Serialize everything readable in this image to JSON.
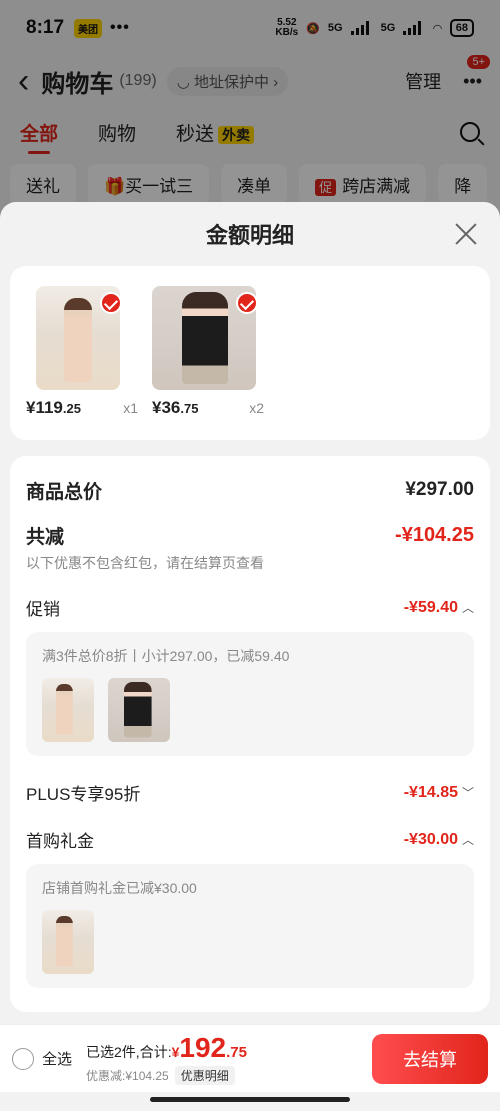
{
  "status_bar": {
    "time": "8:17",
    "badge": "美团",
    "dots": "•••",
    "speed_top": "5.52",
    "speed_bottom": "KB/s",
    "network1": "5G",
    "network2": "5G",
    "battery": "68"
  },
  "nav": {
    "title": "购物车",
    "count": "(199)",
    "address": "◡ 地址保护中 ›",
    "manage": "管理",
    "more_badge": "5+"
  },
  "tabs": {
    "all": "全部",
    "shop": "购物",
    "flash": "秒送",
    "takeout": "外卖"
  },
  "chips": {
    "gift": "送礼",
    "try": "买一试三",
    "bundle": "凑单",
    "promo_icon": "促",
    "promo": "跨店满减",
    "more": "降"
  },
  "sheet": {
    "title": "金额明细",
    "products": [
      {
        "price_int": "¥119",
        "price_dec": ".25",
        "qty": "x1"
      },
      {
        "price_int": "¥36",
        "price_dec": ".75",
        "qty": "x2"
      }
    ],
    "total_label": "商品总价",
    "total_value": "¥297.00",
    "reduce_label": "共减",
    "reduce_value": "-¥104.25",
    "reduce_note": "以下优惠不包含红包，请在结算页查看",
    "promo_label": "促销",
    "promo_value": "-¥59.40",
    "promo_detail": "满3件总价8折丨小计297.00，已减59.40",
    "plus_label": "PLUS专享95折",
    "plus_value": "-¥14.85",
    "first_label": "首购礼金",
    "first_value": "-¥30.00",
    "first_detail": "店铺首购礼金已减¥30.00"
  },
  "bottom": {
    "select_all": "全选",
    "selected_text": "已选2件,合计:",
    "currency": "¥",
    "total_int": "192",
    "total_dec": ".75",
    "discount_text": "优惠减:¥104.25",
    "detail_chip": "优惠明细",
    "checkout": "去结算"
  },
  "colors": {
    "accent": "#e1251b",
    "sheet_bg": "#f2f2f2"
  }
}
